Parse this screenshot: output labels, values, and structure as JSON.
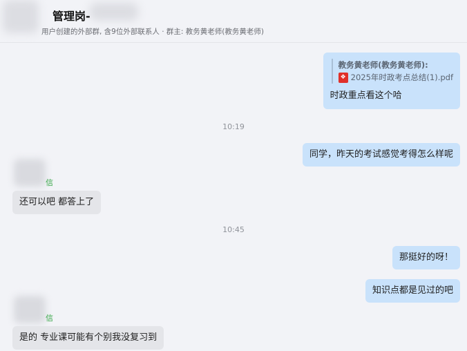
{
  "header": {
    "title": "管理岗-",
    "subtitle": "用户创建的外部群, 含9位外部联系人 · 群主: 教务黄老师(教务黄老师)"
  },
  "messages": [
    {
      "side": "me",
      "quote_name": "教务黄老师(教务黄老师):",
      "quote_file": "2025年时政考点总结(1).pdf",
      "text": "时政重点看这个哈"
    },
    {
      "time": "10:19"
    },
    {
      "side": "me",
      "text": "同学，昨天的考试感觉考得怎么样呢"
    },
    {
      "side": "them",
      "sender": "信",
      "text": "还可以吧 都答上了"
    },
    {
      "time": "10:45"
    },
    {
      "side": "me",
      "text": "那挺好的呀！"
    },
    {
      "side": "me",
      "text": "知识点都是见过的吧"
    },
    {
      "side": "them",
      "sender": "信",
      "text": "是的 专业课可能有个别我没复习到"
    }
  ],
  "icons": {
    "pdf": "pdf-file-icon"
  },
  "colors": {
    "my_bubble": "#c9e2fb",
    "their_bubble": "#e4e5e9",
    "sender_name": "#3aa84a"
  }
}
